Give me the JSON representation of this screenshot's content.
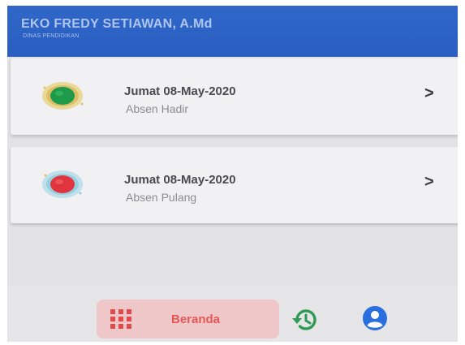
{
  "header": {
    "user_name": "EKO FREDY SETIAWAN, A.Md",
    "department": "DINAS PENDIDIKAN"
  },
  "attendance": [
    {
      "date": "Jumat 08-May-2020",
      "type": "Absen Hadir",
      "status_color": "#1f9a4a",
      "icon": "green-status-dot-icon"
    },
    {
      "date": "Jumat 08-May-2020",
      "type": "Absen Pulang",
      "status_color": "#e0353e",
      "icon": "red-status-dot-icon"
    }
  ],
  "chevron": ">",
  "bottom_nav": {
    "home_label": "Beranda",
    "accent_color": "#e35757",
    "icons": [
      "grid-icon",
      "history-icon",
      "profile-icon"
    ]
  },
  "colors": {
    "header_blue": "#2f67c9",
    "history_green": "#2f9a53",
    "profile_blue": "#2a6fe0"
  }
}
